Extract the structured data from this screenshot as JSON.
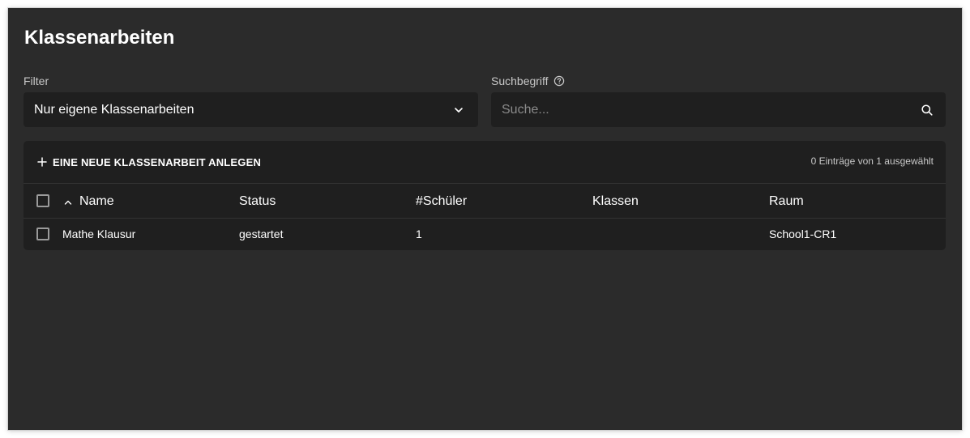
{
  "page": {
    "title": "Klassenarbeiten"
  },
  "filter": {
    "label": "Filter",
    "selected": "Nur eigene Klassenarbeiten",
    "icon": "chevron-down-icon"
  },
  "search": {
    "label": "Suchbegriff",
    "placeholder": "Suche...",
    "value": "",
    "help_icon": "help-circle-icon",
    "icon": "search-icon"
  },
  "table": {
    "add_button_label": "EINE NEUE KLASSENARBEIT ANLEGEN",
    "add_icon": "plus-icon",
    "selection_info": "0 Einträge von 1 ausgewählt",
    "sort_icon": "sort-up-icon",
    "columns": [
      "Name",
      "Status",
      "#Schüler",
      "Klassen",
      "Raum"
    ],
    "rows": [
      [
        "Mathe Klausur",
        "gestartet",
        "1",
        "",
        "School1-CR1"
      ]
    ]
  },
  "colors": {
    "background": "#2b2b2b",
    "surface": "#1f1f1f",
    "text": "#ffffff",
    "muted_text": "#c8c8c8"
  }
}
